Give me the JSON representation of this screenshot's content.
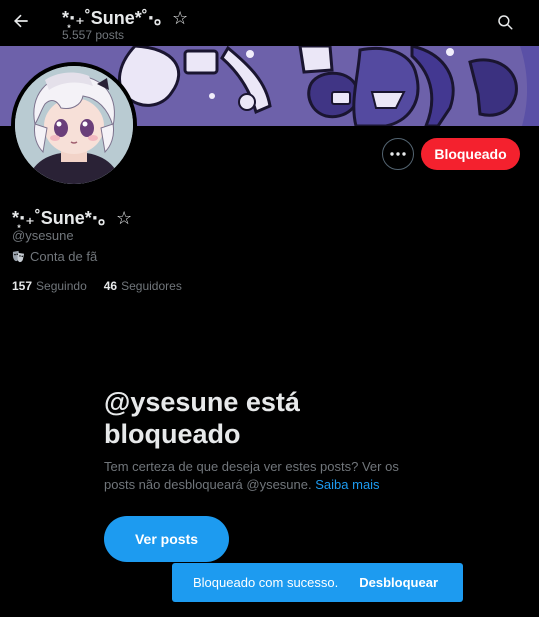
{
  "header": {
    "name": "*͙‧₊˚Sune*˚‧。☆",
    "posts_count": "5.557 posts"
  },
  "profile": {
    "display_name": "*͙‧₊˚Sune*‧。☆",
    "handle": "@ysesune",
    "fan_label": "Conta de fã",
    "following_count": "157",
    "following_label": "Seguindo",
    "followers_count": "46",
    "followers_label": "Seguidores"
  },
  "actions": {
    "blocked_label": "Bloqueado"
  },
  "blocked_notice": {
    "title": "@ysesune está bloqueado",
    "description": "Tem certeza de que deseja ver estes posts? Ver os posts não desbloqueará @ysesune.",
    "learn_more": "Saiba mais",
    "view_posts": "Ver posts"
  },
  "toast": {
    "message": "Bloqueado com sucesso.",
    "action": "Desbloquear"
  },
  "colors": {
    "accent": "#1d9bf0",
    "danger": "#f4212e",
    "background": "#000000",
    "muted": "#71767b"
  }
}
